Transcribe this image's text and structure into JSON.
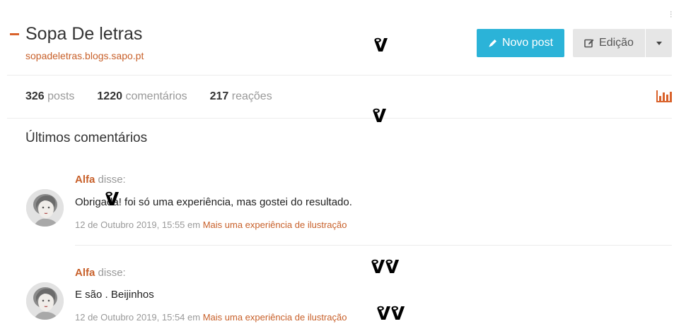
{
  "blog": {
    "title": "Sopa De letras",
    "url": "sopadeletras.blogs.sapo.pt"
  },
  "actions": {
    "new_post_label": "Novo post",
    "edit_label": "Edição"
  },
  "stats": [
    {
      "num": "326",
      "label": "posts"
    },
    {
      "num": "1220",
      "label": "comentários"
    },
    {
      "num": "217",
      "label": "reações"
    }
  ],
  "section": {
    "title": "Últimos comentários"
  },
  "comments": [
    {
      "author": "Alfa",
      "said": "disse:",
      "text": "Obrigada! foi só uma experiência, mas gostei do resultado.",
      "date": "12 de Outubro 2019, 15:55",
      "in": "em",
      "post": "Mais uma experiência de ilustração"
    },
    {
      "author": "Alfa",
      "said": "disse:",
      "text": "E são . Beijinhos",
      "date": "12 de Outubro 2019, 15:54",
      "in": "em",
      "post": "Mais uma experiência de ilustração"
    }
  ],
  "colors": {
    "accent": "#c8602a",
    "primary_button": "#2bb3d8",
    "secondary_button": "#e6e6e6"
  },
  "icons": {
    "new_post": "pencil-icon",
    "edit": "edit-square-icon",
    "stats": "bar-chart-icon",
    "dropdown": "caret-down-icon"
  }
}
